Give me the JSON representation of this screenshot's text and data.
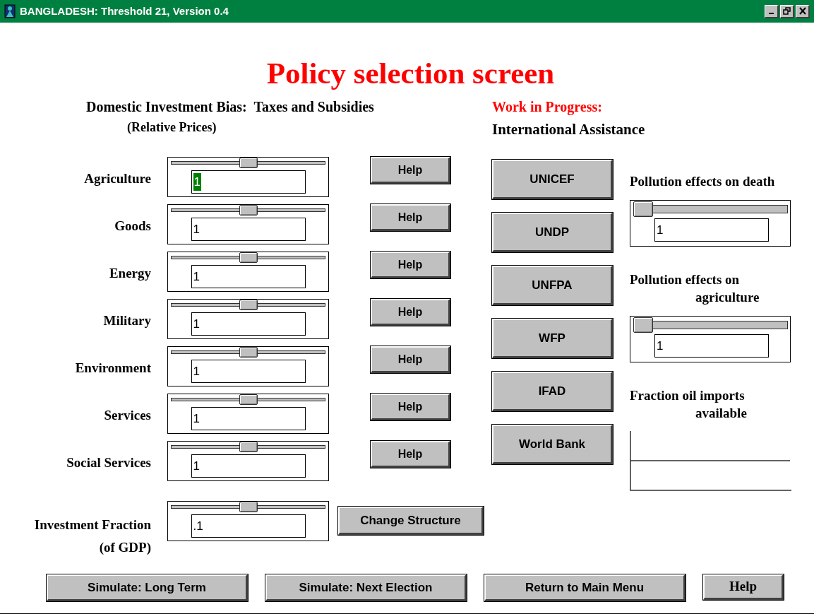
{
  "window": {
    "title": "BANGLADESH: Threshold 21, Version 0.4"
  },
  "heading": "Policy selection screen",
  "domestic": {
    "title": "Domestic Investment Bias:  Taxes and Subsidies",
    "subtitle": "(Relative Prices)",
    "rows": [
      {
        "label": "Agriculture",
        "level": 0.5,
        "value": "1",
        "value_selected": true,
        "help": "Help"
      },
      {
        "label": "Goods",
        "level": 0.5,
        "value": "1",
        "value_selected": false,
        "help": "Help"
      },
      {
        "label": "Energy",
        "level": 0.5,
        "value": "1",
        "value_selected": false,
        "help": "Help"
      },
      {
        "label": "Military",
        "level": 0.5,
        "value": "1",
        "value_selected": false,
        "help": "Help"
      },
      {
        "label": "Environment",
        "level": 0.5,
        "value": "1",
        "value_selected": false,
        "help": "Help"
      },
      {
        "label": "Services",
        "level": 0.5,
        "value": "1",
        "value_selected": false,
        "help": "Help"
      },
      {
        "label": "Social Services",
        "level": 0.5,
        "value": "1",
        "value_selected": false,
        "help": "Help"
      }
    ]
  },
  "investment": {
    "label": "Investment Fraction",
    "sublabel": "(of GDP)",
    "level": 0.5,
    "value": ".1",
    "button": "Change Structure"
  },
  "international": {
    "note": "Work in Progress:",
    "title": "International Assistance",
    "buttons": [
      "UNICEF",
      "UNDP",
      "UNFPA",
      "WFP",
      "IFAD",
      "World Bank"
    ]
  },
  "effects": [
    {
      "kind": "slider",
      "label_lines": [
        "Pollution effects on death"
      ],
      "level": 0,
      "value": "1"
    },
    {
      "kind": "slider",
      "label_lines": [
        "Pollution effects on",
        "agriculture"
      ],
      "level": 0,
      "value": "1"
    },
    {
      "kind": "graph",
      "label_lines": [
        "Fraction oil imports",
        "available"
      ]
    }
  ],
  "bottom_buttons": [
    {
      "kind": "wide",
      "label": "Simulate: Long Term"
    },
    {
      "kind": "wide",
      "label": "Simulate: Next Election"
    },
    {
      "kind": "wide",
      "label": "Return to Main Menu"
    },
    {
      "kind": "narrow",
      "label": "Help"
    }
  ]
}
